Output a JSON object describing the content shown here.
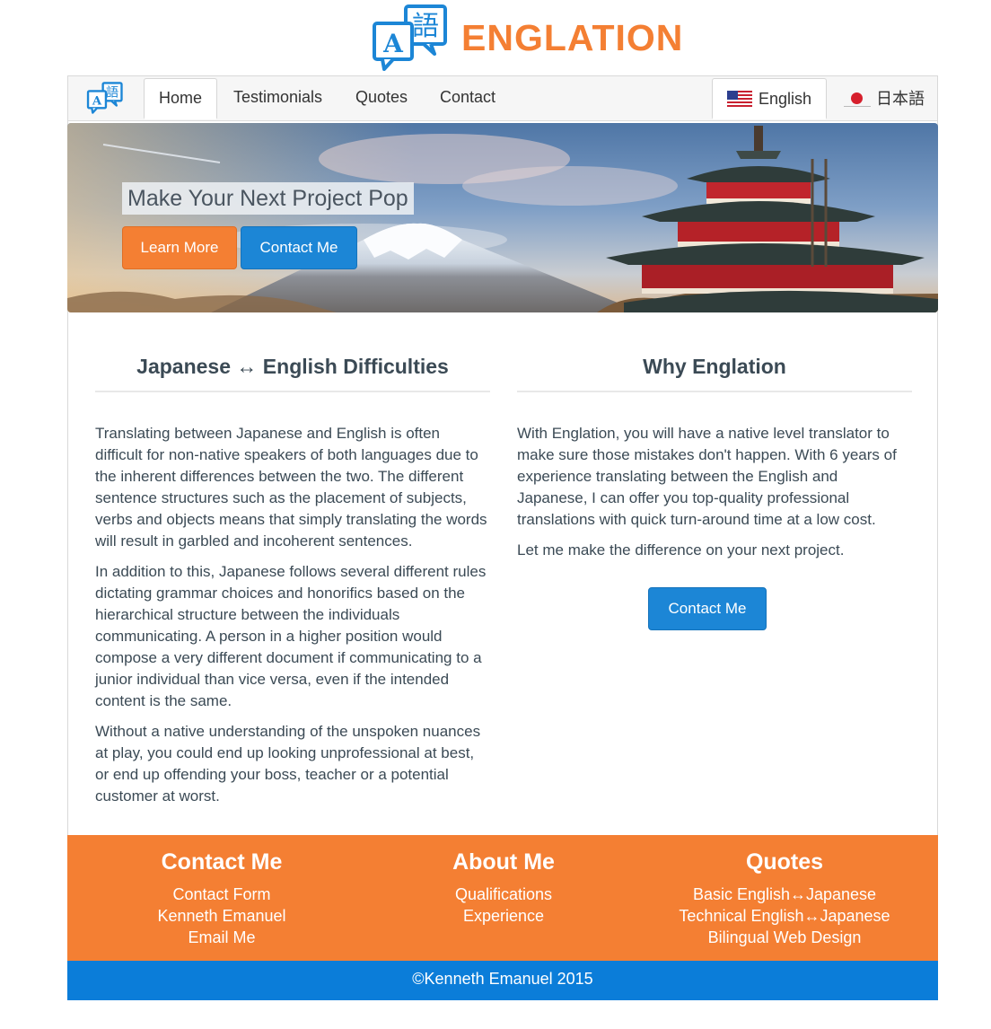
{
  "brand": {
    "name": "ENGLATION",
    "logo_icon": "translation-bubbles-icon",
    "logo_letter": "A",
    "logo_kanji": "語",
    "color_orange": "#f47f33",
    "color_blue": "#1c86d6"
  },
  "nav": {
    "items": [
      {
        "label": "Home",
        "active": true
      },
      {
        "label": "Testimonials",
        "active": false
      },
      {
        "label": "Quotes",
        "active": false
      },
      {
        "label": "Contact",
        "active": false
      }
    ],
    "languages": [
      {
        "label": "English",
        "icon": "us-flag-icon",
        "active": true
      },
      {
        "label": "日本語",
        "icon": "japan-flag-icon",
        "active": false
      }
    ]
  },
  "hero": {
    "title": "Make Your Next Project Pop",
    "learn_more": "Learn More",
    "contact_me": "Contact Me"
  },
  "left_column": {
    "heading": "Japanese ↔ English Difficulties",
    "paragraphs": [
      "Translating between Japanese and English is often difficult for non-native speakers of both languages due to the inherent differences between the two. The different sentence structures such as the placement of subjects, verbs and objects means that simply translating the words will result in garbled and incoherent sentences.",
      "In addition to this, Japanese follows several different rules dictating grammar choices and honorifics based on the hierarchical structure between the individuals communicating. A person in a higher position would compose a very different document if communicating to a junior individual than vice versa, even if the intended content is the same.",
      "Without a native understanding of the unspoken nuances at play, you could end up looking unprofessional at best, or end up offending your boss, teacher or a potential customer at worst."
    ]
  },
  "right_column": {
    "heading": "Why Englation",
    "paragraphs": [
      "With Englation, you will have a native level translator to make sure those mistakes don't happen. With 6 years of experience translating between the English and Japanese, I can offer you top-quality professional translations with quick turn-around time at a low cost.",
      "Let me make the difference on your next project."
    ],
    "button": "Contact Me"
  },
  "footer": {
    "columns": [
      {
        "heading": "Contact Me",
        "links": [
          "Contact Form",
          "Kenneth Emanuel",
          "Email Me"
        ]
      },
      {
        "heading": "About Me",
        "links": [
          "Qualifications",
          "Experience"
        ]
      },
      {
        "heading": "Quotes",
        "links": [
          "Basic English↔Japanese",
          "Technical English↔Japanese",
          "Bilingual Web Design"
        ]
      }
    ],
    "copyright": "©Kenneth Emanuel 2015"
  }
}
